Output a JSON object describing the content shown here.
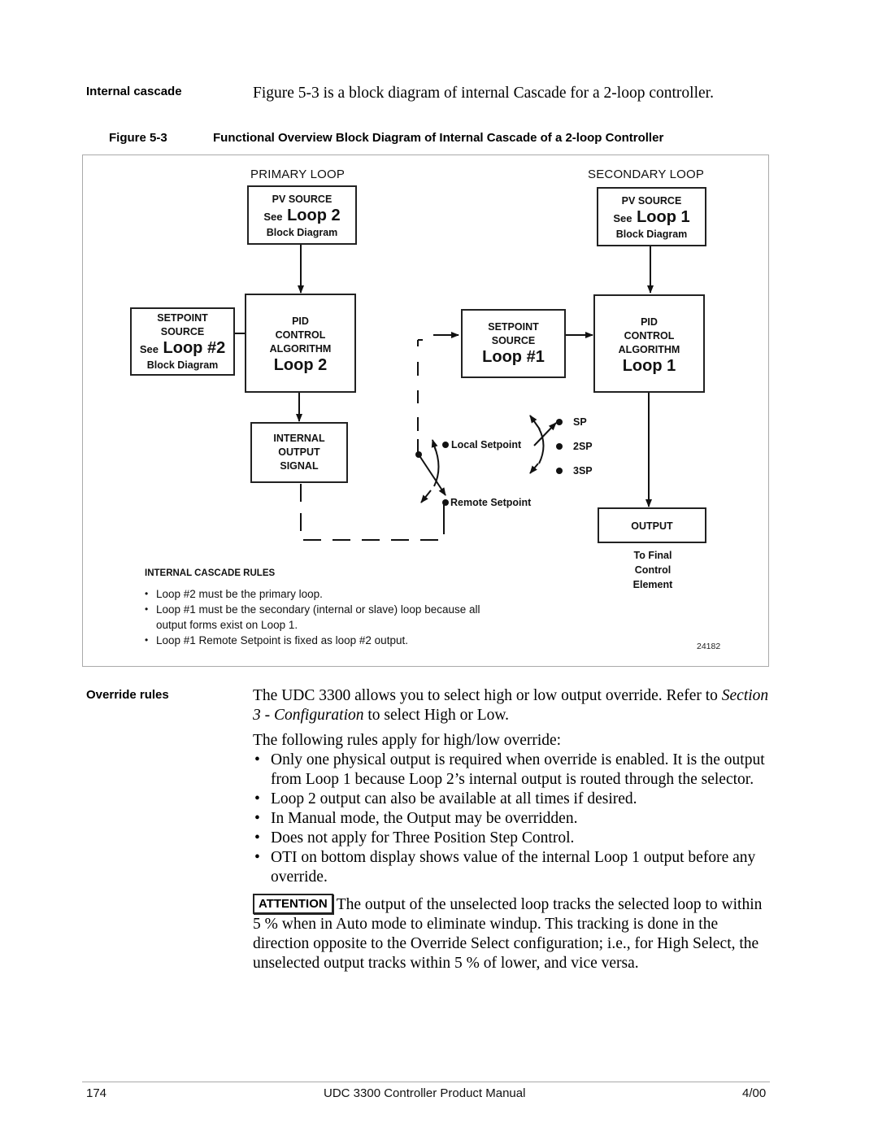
{
  "intro": {
    "side_heading": "Internal cascade",
    "text": "Figure 5-3 is a block diagram of internal Cascade for a 2-loop controller."
  },
  "figure": {
    "number": "Figure 5-3",
    "title": "Functional Overview Block Diagram of Internal Cascade of a 2-loop Controller",
    "id_code": "24182",
    "primary": {
      "heading": "PRIMARY LOOP",
      "pv_source": {
        "line1": "PV SOURCE",
        "see": "See",
        "loop": "Loop 2",
        "line3": "Block Diagram"
      },
      "setpoint_source": {
        "line1": "SETPOINT",
        "line2": "SOURCE",
        "see": "See",
        "loop": "Loop #2",
        "line4": "Block Diagram"
      },
      "pid": {
        "line1": "PID",
        "line2": "CONTROL",
        "line3": "ALGORITHM",
        "loop": "Loop 2"
      },
      "internal_output": {
        "line1": "INTERNAL",
        "line2": "OUTPUT",
        "line3": "SIGNAL"
      }
    },
    "secondary": {
      "heading": "SECONDARY LOOP",
      "pv_source": {
        "line1": "PV SOURCE",
        "see": "See",
        "loop": "Loop 1",
        "line3": "Block Diagram"
      },
      "setpoint_source": {
        "line1": "SETPOINT",
        "line2": "SOURCE",
        "loop": "Loop #1"
      },
      "pid": {
        "line1": "PID",
        "line2": "CONTROL",
        "line3": "ALGORITHM",
        "loop": "Loop 1"
      },
      "output": {
        "label": "OUTPUT",
        "note_line1": "To Final",
        "note_line2": "Control",
        "note_line3": "Element"
      }
    },
    "switch_labels": {
      "local_setpoint": "Local Setpoint",
      "remote_setpoint": "Remote Setpoint",
      "sp": "SP",
      "sp2": "2SP",
      "sp3": "3SP"
    },
    "rules": {
      "title": "INTERNAL CASCADE RULES",
      "items": [
        "Loop #2 must be the primary loop.",
        "Loop #1 must be the secondary (internal or slave) loop because all output forms exist on Loop 1.",
        "Loop #1 Remote Setpoint is fixed as loop #2 output."
      ]
    }
  },
  "override": {
    "side_heading": "Override rules",
    "para1_pre": "The UDC 3300 allows you to select high or low output override. Refer to ",
    "para1_italic": "Section 3 - Configuration",
    "para1_post": " to select High or Low.",
    "para2": "The following rules apply for high/low override:",
    "bullets": [
      "Only one physical output is required when override is enabled. It is the output from Loop 1 because Loop 2’s internal output is routed through the selector.",
      "Loop 2 output can also be available at all times if desired.",
      "In Manual mode, the Output may be overridden.",
      "Does not apply for Three Position Step Control.",
      "OTI on bottom display shows value of the internal Loop 1 output before any override."
    ],
    "attention_label": "ATTENTION",
    "attention_text": "The output of the unselected loop tracks the selected loop to within 5 % when in Auto mode to eliminate windup. This tracking is done in the direction opposite to the Override Select configuration; i.e., for High Select, the unselected output tracks within 5 % of lower, and vice versa."
  },
  "footer": {
    "page_number": "174",
    "title": "UDC 3300 Controller Product Manual",
    "date": "4/00"
  }
}
